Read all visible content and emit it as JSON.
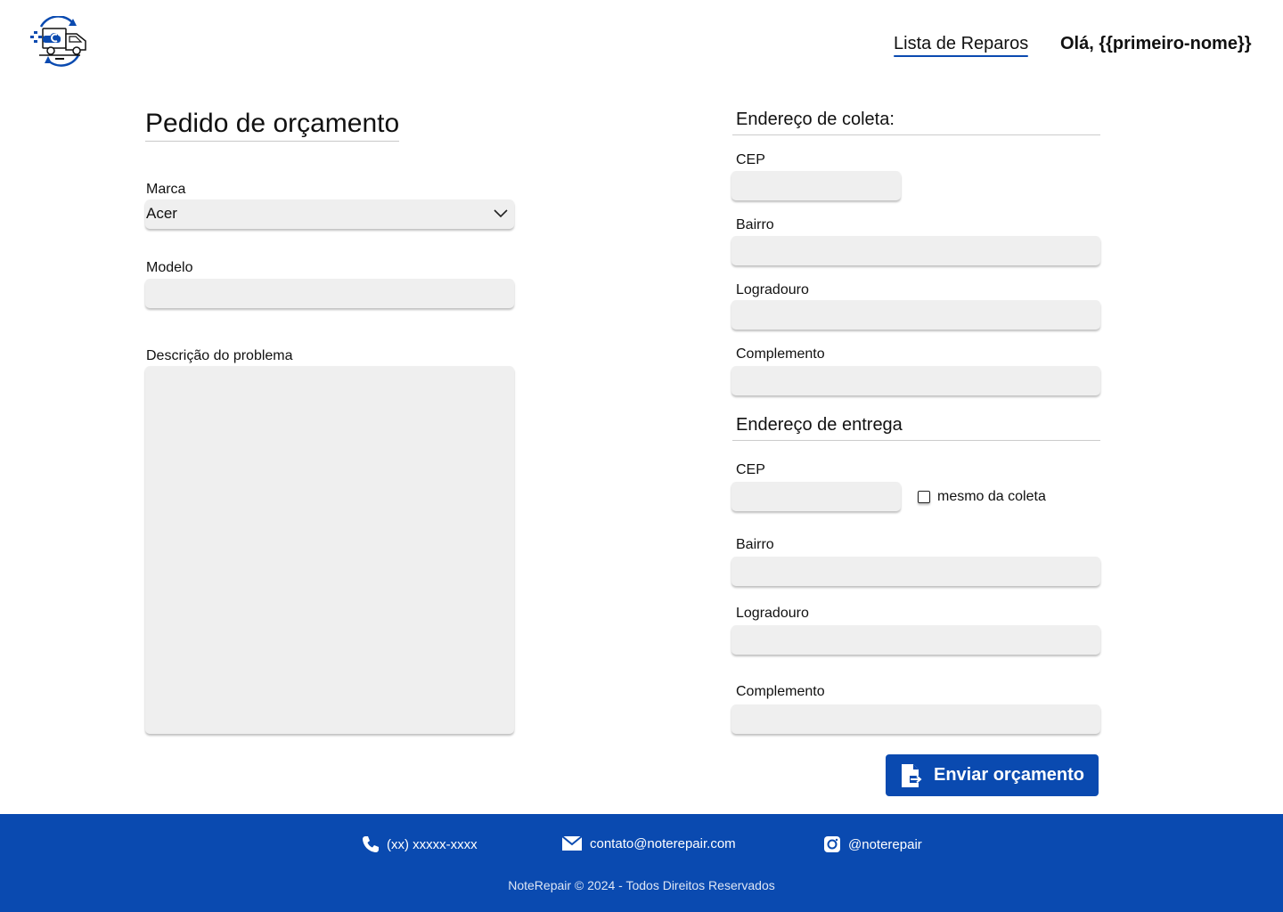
{
  "header": {
    "logo_icon": "repair-truck-logo",
    "nav_link": "Lista de Reparos",
    "greeting": "Olá, {{primeiro-nome}}"
  },
  "form": {
    "title": "Pedido de orçamento",
    "brand": {
      "label": "Marca",
      "value": "Acer"
    },
    "model": {
      "label": "Modelo",
      "value": ""
    },
    "description": {
      "label": "Descrição do problema",
      "value": ""
    }
  },
  "pickup": {
    "title": "Endereço de coleta:",
    "cep_label": "CEP",
    "bairro_label": "Bairro",
    "logradouro_label": "Logradouro",
    "complemento_label": "Complemento"
  },
  "delivery": {
    "title": "Endereço de entrega",
    "cep_label": "CEP",
    "same_as_pickup_label": "mesmo da coleta",
    "same_as_pickup_checked": false,
    "bairro_label": "Bairro",
    "logradouro_label": "Logradouro",
    "complemento_label": "Complemento"
  },
  "submit": {
    "label": "Enviar orçamento",
    "icon": "send-document-icon"
  },
  "footer": {
    "phone": "(xx) xxxxx-xxxx",
    "email": "contato@noterepair.com",
    "instagram": "@noterepair",
    "copyright": "NoteRepair © 2024 - Todos Direitos Reservados"
  },
  "colors": {
    "brand_blue": "#0a4ab0",
    "field_bg": "#efefef"
  }
}
